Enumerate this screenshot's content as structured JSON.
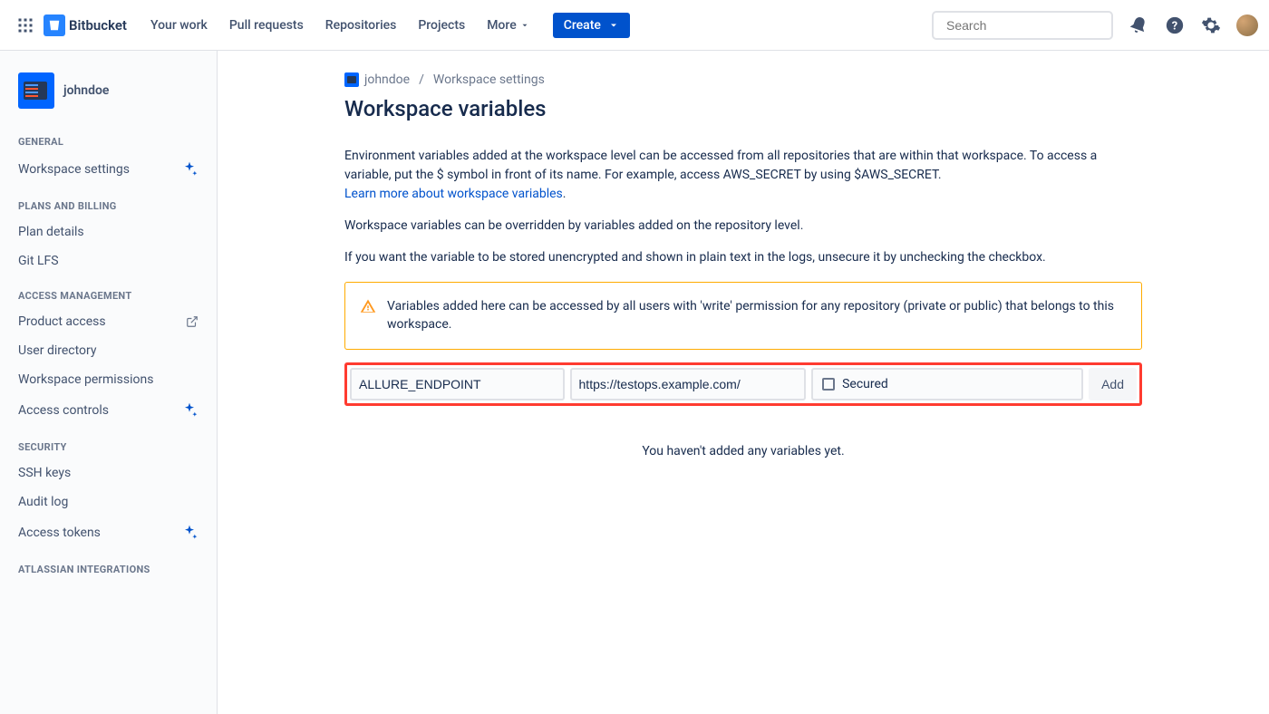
{
  "topnav": {
    "product_name": "Bitbucket",
    "items": [
      "Your work",
      "Pull requests",
      "Repositories",
      "Projects"
    ],
    "more_label": "More",
    "create_label": "Create",
    "search_placeholder": "Search"
  },
  "sidebar": {
    "workspace_name": "johndoe",
    "sections": {
      "general": {
        "label": "GENERAL",
        "items": [
          {
            "label": "Workspace settings",
            "sparkle": true
          }
        ]
      },
      "plans": {
        "label": "PLANS AND BILLING",
        "items": [
          {
            "label": "Plan details"
          },
          {
            "label": "Git LFS"
          }
        ]
      },
      "access": {
        "label": "ACCESS MANAGEMENT",
        "items": [
          {
            "label": "Product access",
            "external": true
          },
          {
            "label": "User directory"
          },
          {
            "label": "Workspace permissions"
          },
          {
            "label": "Access controls",
            "sparkle": true
          }
        ]
      },
      "security": {
        "label": "SECURITY",
        "items": [
          {
            "label": "SSH keys"
          },
          {
            "label": "Audit log"
          },
          {
            "label": "Access tokens",
            "sparkle": true
          }
        ]
      },
      "integrations": {
        "label": "ATLASSIAN INTEGRATIONS"
      }
    }
  },
  "breadcrumb": {
    "workspace": "johndoe",
    "separator": "/",
    "current": "Workspace settings"
  },
  "page": {
    "title": "Workspace variables",
    "desc1": "Environment variables added at the workspace level can be accessed from all repositories that are within that workspace. To access a variable, put the $ symbol in front of its name. For example, access AWS_SECRET by using $AWS_SECRET.",
    "learn_more": "Learn more about workspace variables",
    "desc2": "Workspace variables can be overridden by variables added on the repository level.",
    "desc3": "If you want the variable to be stored unencrypted and shown in plain text in the logs, unsecure it by unchecking the checkbox.",
    "warning": "Variables added here can be accessed by all users with 'write' permission for any repository (private or public) that belongs to this workspace.",
    "empty": "You haven't added any variables yet."
  },
  "var_form": {
    "name_value": "ALLURE_ENDPOINT",
    "value_value": "https://testops.example.com/",
    "secured_label": "Secured",
    "add_label": "Add"
  }
}
